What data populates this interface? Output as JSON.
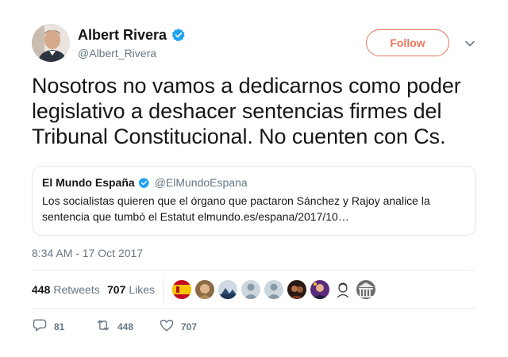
{
  "author": {
    "display_name": "Albert Rivera",
    "handle": "@Albert_Rivera",
    "verified_icon": "verified-badge-icon"
  },
  "follow_label": "Follow",
  "tweet": {
    "text": "Nosotros no vamos a dedicarnos como poder legislativo a deshacer sentencias firmes del Tribunal Constitucional. No cuenten con Cs."
  },
  "quoted_tweet": {
    "name": "El Mundo España",
    "handle": "@ElMundoEspana",
    "text": "Los socialistas quieren que el órgano que pactaron Sánchez y Rajoy analice la sentencia que tumbó el Estatut elmundo.es/espana/2017/10…"
  },
  "timestamp": "8:34 AM - 17 Oct 2017",
  "stats": {
    "retweets_count": "448",
    "retweets_label": "Retweets",
    "likes_count": "707",
    "likes_label": "Likes"
  },
  "actions": {
    "replies": "81",
    "retweets": "448",
    "likes": "707"
  },
  "colors": {
    "follow_accent": "#e8765a",
    "verified_blue": "#1da1f2",
    "secondary_text": "#657786"
  }
}
